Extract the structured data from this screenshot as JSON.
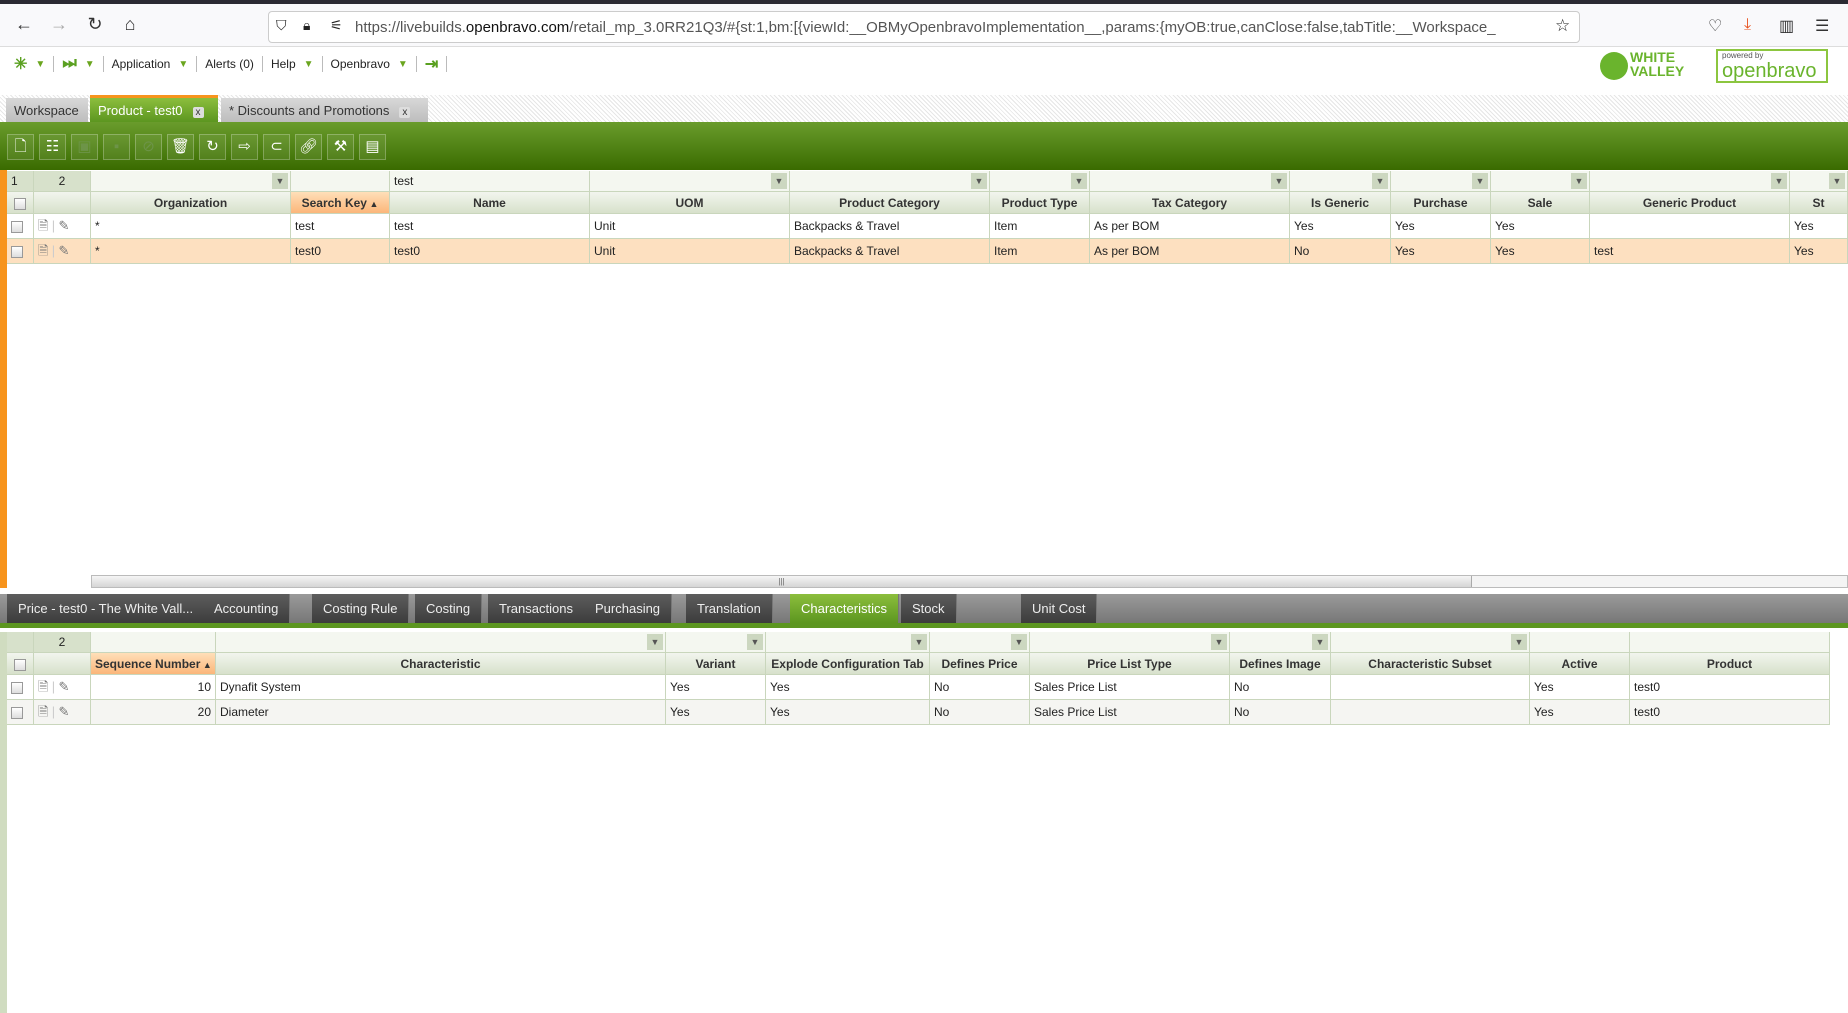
{
  "browser": {
    "url_prefix": "https://livebuilds.",
    "url_domain": "openbravo.com",
    "url_rest": "/retail_mp_3.0RR21Q3/#{st:1,bm:[{viewId:__OBMyOpenbravoImplementation__,params:{myOB:true,canClose:false,tabTitle:__Workspace_"
  },
  "menu": {
    "application": "Application",
    "alerts": "Alerts (0)",
    "help": "Help",
    "user": "Openbravo"
  },
  "logos": {
    "white_valley": "WHITE VALLEY",
    "openbravo": "powered by openbravo"
  },
  "tabs": [
    {
      "label": "Workspace"
    },
    {
      "label": "Product - test0"
    },
    {
      "label": "* Discounts and Promotions"
    }
  ],
  "top_grid": {
    "page_num": "1",
    "count": "2",
    "filter_name": "test",
    "columns": [
      "Organization",
      "Search Key",
      "Name",
      "UOM",
      "Product Category",
      "Product Type",
      "Tax Category",
      "Is Generic",
      "Purchase",
      "Sale",
      "Generic Product",
      "St"
    ],
    "rows": [
      [
        "*",
        "test",
        "test",
        "Unit",
        "Backpacks & Travel",
        "Item",
        "As per BOM",
        "Yes",
        "Yes",
        "Yes",
        "",
        "Yes"
      ],
      [
        "*",
        "test0",
        "test0",
        "Unit",
        "Backpacks & Travel",
        "Item",
        "As per BOM",
        "No",
        "Yes",
        "Yes",
        "test",
        "Yes"
      ]
    ]
  },
  "subtabs": [
    "Price - test0 - The White Vall...",
    "Accounting",
    "Costing Rule",
    "Costing",
    "Transactions",
    "Purchasing",
    "Translation",
    "Characteristics",
    "Stock",
    "Unit Cost"
  ],
  "bottom_grid": {
    "count": "2",
    "columns": [
      "Sequence Number",
      "Characteristic",
      "Variant",
      "Explode Configuration Tab",
      "Defines Price",
      "Price List Type",
      "Defines Image",
      "Characteristic Subset",
      "Active",
      "Product"
    ],
    "rows": [
      [
        "10",
        "Dynafit System",
        "Yes",
        "Yes",
        "No",
        "Sales Price List",
        "No",
        "",
        "Yes",
        "test0"
      ],
      [
        "20",
        "Diameter",
        "Yes",
        "Yes",
        "No",
        "Sales Price List",
        "No",
        "",
        "Yes",
        "test0"
      ]
    ]
  },
  "colors": {
    "accent": "#5c9620",
    "orange": "#f7941d"
  }
}
